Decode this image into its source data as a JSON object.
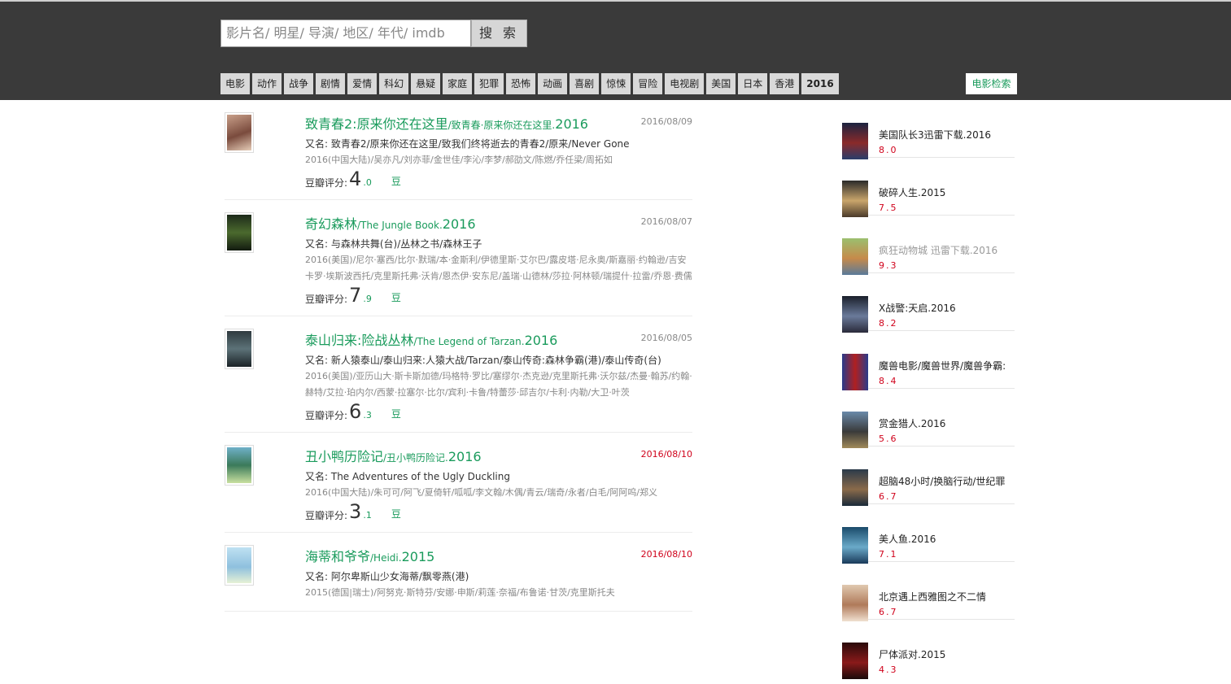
{
  "search": {
    "placeholder": "影片名/ 明星/ 导演/ 地区/ 年代/ imdb",
    "button": "搜 索"
  },
  "nav": [
    "电影",
    "动作",
    "战争",
    "剧情",
    "爱情",
    "科幻",
    "悬疑",
    "家庭",
    "犯罪",
    "恐怖",
    "动画",
    "喜剧",
    "惊悚",
    "冒险",
    "电视剧",
    "美国",
    "日本",
    "香港",
    "2016"
  ],
  "nav_right": "电影检索",
  "movies": [
    {
      "title": "致青春2:原来你还在这里",
      "sub": "/致青春·原来你还在这里.",
      "year": "2016",
      "date": "2016/08/09",
      "aka_label": "又名:",
      "aka": "致青春2/原来你还在这里/致我们终将逝去的青春2/原来/Never Gone",
      "meta": "2016(中国大陆)/吴亦凡/刘亦菲/金世佳/李沁/李梦/郝劭文/陈燃/乔任梁/周拓如",
      "rating_label": "豆瓣评分:",
      "score_int": "4",
      "score_dec": ".0",
      "dou": "豆"
    },
    {
      "title": "奇幻森林",
      "sub": "/The Jungle Book.",
      "year": "2016",
      "date": "2016/08/07",
      "aka_label": "又名:",
      "aka": "与森林共舞(台)/丛林之书/森林王子",
      "meta": "2016(美国)/尼尔·塞西/比尔·默瑞/本·金斯利/伊德里斯·艾尔巴/露皮塔·尼永奥/斯嘉丽·约翰逊/吉安卡罗·埃斯波西托/克里斯托弗·沃肯/恩杰伊·安东尼/盖瑞·山德林/莎拉·阿林顿/瑞提什·拉雷/乔恩·费儒",
      "rating_label": "豆瓣评分:",
      "score_int": "7",
      "score_dec": ".9",
      "dou": "豆"
    },
    {
      "title": "泰山归来:险战丛林",
      "sub": "/The Legend of Tarzan.",
      "year": "2016",
      "date": "2016/08/05",
      "aka_label": "又名:",
      "aka": "新人猿泰山/泰山归来:人猿大战/Tarzan/泰山传奇:森林争霸(港)/泰山传奇(台)",
      "meta": "2016(美国)/亚历山大·斯卡斯加德/玛格特·罗比/塞缪尔·杰克逊/克里斯托弗·沃尔兹/杰曼·翰苏/约翰·赫特/艾拉·珀内尔/西蒙·拉塞尔·比尔/宾利·卡鲁/特蕾莎·邱吉尔/卡利·内勒/大卫·叶茨",
      "rating_label": "豆瓣评分:",
      "score_int": "6",
      "score_dec": ".3",
      "dou": "豆"
    },
    {
      "title": "丑小鸭历险记",
      "sub": "/丑小鸭历险记.",
      "year": "2016",
      "date": "2016/08/10",
      "aka_label": "又名:",
      "aka": "The Adventures of the Ugly Duckling",
      "meta": "2016(中国大陆)/朱可可/阿飞/夏倚轩/呱呱/李文翰/木偶/青云/瑞奇/永者/白毛/阿阿呜/郑义",
      "rating_label": "豆瓣评分:",
      "score_int": "3",
      "score_dec": ".1",
      "dou": "豆"
    },
    {
      "title": "海蒂和爷爷",
      "sub": "/Heidi.",
      "year": "2015",
      "date": "2016/08/10",
      "aka_label": "又名:",
      "aka": "阿尔卑斯山少女海蒂/飘零燕(港)",
      "meta": "2015(德国|瑞士)/阿努克·斯特芬/安娜·申斯/莉莲·奈福/布鲁诺·甘茨/克里斯托夫",
      "rating_label": "",
      "score_int": "",
      "score_dec": "",
      "dou": ""
    }
  ],
  "sidebar": [
    {
      "title": "美国队长3迅雷下载.2016",
      "score": "8.0"
    },
    {
      "title": "破碎人生.2015",
      "score": "7.5"
    },
    {
      "title": "疯狂动物城 迅雷下载.2016",
      "score": "9.3"
    },
    {
      "title": "X战警:天启.2016",
      "score": "8.2"
    },
    {
      "title": "魔兽电影/魔兽世界/魔兽争霸:",
      "score": "8.4"
    },
    {
      "title": "赏金猎人.2016",
      "score": "5.6"
    },
    {
      "title": "超脑48小时/换脑行动/世纪罪",
      "score": "6.7"
    },
    {
      "title": "美人鱼.2016",
      "score": "7.1"
    },
    {
      "title": "北京遇上西雅图之不二情",
      "score": "6.7"
    },
    {
      "title": "尸体派对.2015",
      "score": "4.3"
    }
  ],
  "colors": {
    "accent": "#1a9b5c",
    "topbar": "#3a3a3a",
    "score_red": "#d0021b"
  }
}
